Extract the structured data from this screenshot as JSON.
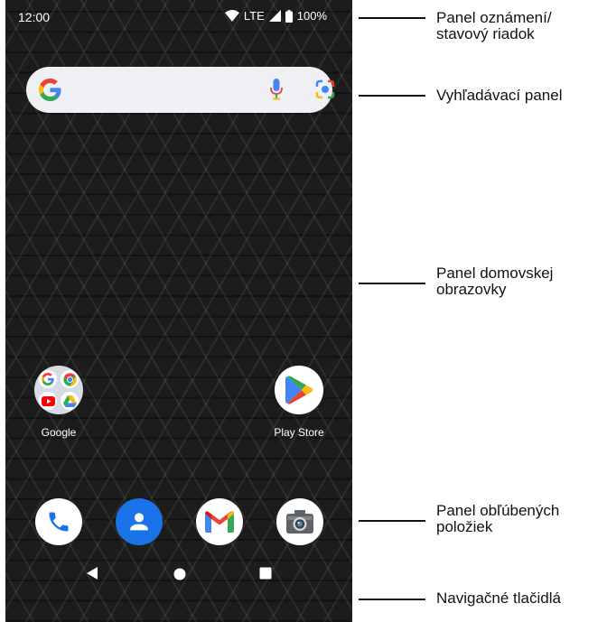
{
  "status_bar": {
    "time": "12:00",
    "network": "LTE",
    "battery": "100%"
  },
  "search_bar": {
    "icons": [
      "google-g-icon",
      "microphone-icon",
      "lens-camera-icon"
    ]
  },
  "home_apps": [
    {
      "label": "Google",
      "icon": "google-folder-icon"
    },
    {
      "label": "Play Store",
      "icon": "play-store-icon"
    }
  ],
  "dock": [
    {
      "icon": "phone-icon"
    },
    {
      "icon": "contacts-icon"
    },
    {
      "icon": "gmail-icon"
    },
    {
      "icon": "camera-icon"
    }
  ],
  "nav_buttons": [
    "back-icon",
    "home-icon",
    "recents-icon"
  ],
  "callouts": [
    {
      "lines": [
        "Panel oznámení/",
        "stavový riadok"
      ]
    },
    {
      "lines": [
        "Vyhľadávací panel"
      ]
    },
    {
      "lines": [
        "Panel domovskej",
        "obrazovky"
      ]
    },
    {
      "lines": [
        "Panel obľúbených",
        "položiek"
      ]
    },
    {
      "lines": [
        "Navigačné tlačidlá"
      ]
    }
  ],
  "colors": {
    "wallpaper": "#1c1c1c",
    "search_bar": "#eef0f4",
    "google_blue": "#4285F4",
    "google_red": "#EA4335",
    "google_yellow": "#FBBC05",
    "google_green": "#34A853",
    "contacts_blue": "#1a73e8"
  }
}
